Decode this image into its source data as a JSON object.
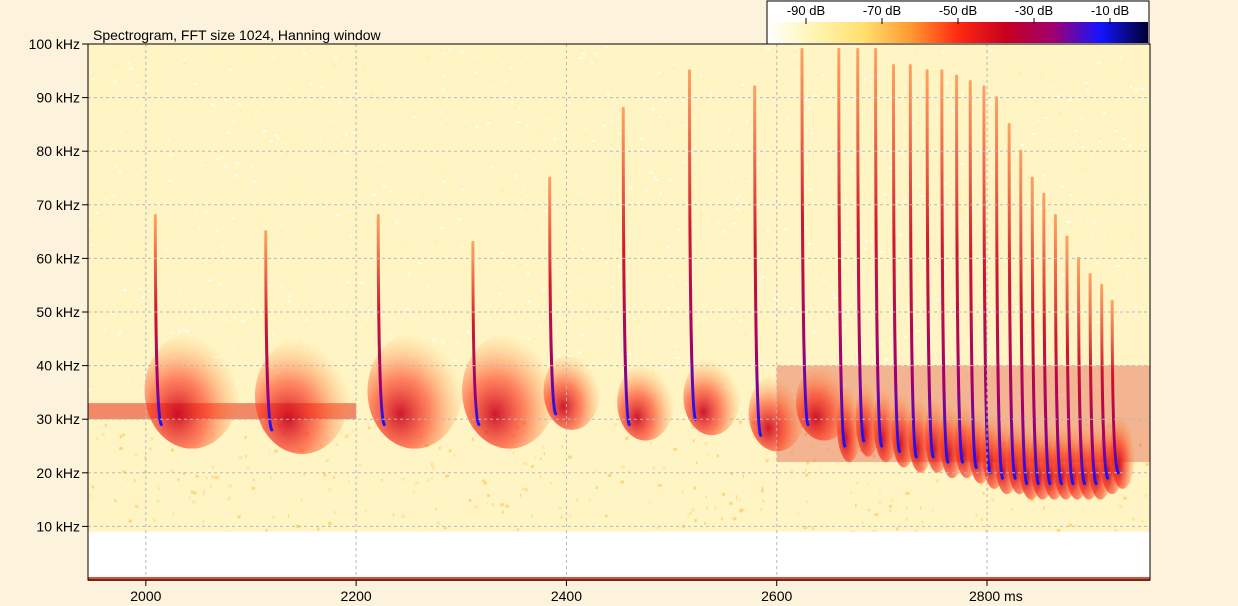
{
  "chart_data": {
    "type": "heatmap",
    "title": "Spectrogram, FFT size 1024, Hanning window",
    "x_unit_label": "ms",
    "y_unit_label": "kHz",
    "xlim": [
      1945,
      2955
    ],
    "ylim": [
      0,
      100
    ],
    "x_ticks": [
      2000,
      2200,
      2400,
      2600,
      2800
    ],
    "y_ticks": [
      10,
      20,
      30,
      40,
      50,
      60,
      70,
      80,
      90,
      100
    ],
    "x_tick_labels": [
      "2000",
      "2200",
      "2400",
      "2600",
      "2800 ms"
    ],
    "y_tick_labels": [
      "10 kHz",
      "20 kHz",
      "30 kHz",
      "40 kHz",
      "50 kHz",
      "60 kHz",
      "70 kHz",
      "80 kHz",
      "90 kHz",
      "100 kHz"
    ],
    "grid": true,
    "colorbar": {
      "range_db": [
        -100,
        0
      ],
      "ticks_db": [
        -90,
        -70,
        -50,
        -30,
        -10
      ],
      "tick_labels": [
        "-90 dB",
        "-70 dB",
        "-50 dB",
        "-30 dB",
        "-10 dB"
      ],
      "placement": "top-right",
      "colors": [
        "#ffffff",
        "#fff4b0",
        "#ffe070",
        "#ff9a30",
        "#ff2a10",
        "#c8001e",
        "#a00070",
        "#1414ff",
        "#000030"
      ]
    },
    "calls": [
      {
        "t": 2010,
        "f_start": 68,
        "f_end": 29
      },
      {
        "t": 2115,
        "f_start": 65,
        "f_end": 28
      },
      {
        "t": 2222,
        "f_start": 68,
        "f_end": 29
      },
      {
        "t": 2312,
        "f_start": 63,
        "f_end": 29
      },
      {
        "t": 2385,
        "f_start": 75,
        "f_end": 31
      },
      {
        "t": 2455,
        "f_start": 88,
        "f_end": 29
      },
      {
        "t": 2518,
        "f_start": 95,
        "f_end": 30
      },
      {
        "t": 2580,
        "f_start": 92,
        "f_end": 27
      },
      {
        "t": 2625,
        "f_start": 99,
        "f_end": 29
      },
      {
        "t": 2660,
        "f_start": 99,
        "f_end": 25
      },
      {
        "t": 2678,
        "f_start": 99,
        "f_end": 26
      },
      {
        "t": 2695,
        "f_start": 99,
        "f_end": 25
      },
      {
        "t": 2712,
        "f_start": 96,
        "f_end": 24
      },
      {
        "t": 2728,
        "f_start": 96,
        "f_end": 23
      },
      {
        "t": 2744,
        "f_start": 95,
        "f_end": 23
      },
      {
        "t": 2758,
        "f_start": 95,
        "f_end": 22
      },
      {
        "t": 2772,
        "f_start": 94,
        "f_end": 22
      },
      {
        "t": 2785,
        "f_start": 93,
        "f_end": 21
      },
      {
        "t": 2798,
        "f_start": 92,
        "f_end": 20
      },
      {
        "t": 2810,
        "f_start": 90,
        "f_end": 19
      },
      {
        "t": 2822,
        "f_start": 85,
        "f_end": 19
      },
      {
        "t": 2833,
        "f_start": 80,
        "f_end": 18
      },
      {
        "t": 2844,
        "f_start": 75,
        "f_end": 18
      },
      {
        "t": 2855,
        "f_start": 72,
        "f_end": 18
      },
      {
        "t": 2866,
        "f_start": 68,
        "f_end": 18
      },
      {
        "t": 2877,
        "f_start": 64,
        "f_end": 18
      },
      {
        "t": 2888,
        "f_start": 60,
        "f_end": 18
      },
      {
        "t": 2899,
        "f_start": 57,
        "f_end": 18
      },
      {
        "t": 2910,
        "f_start": 55,
        "f_end": 19
      },
      {
        "t": 2920,
        "f_start": 52,
        "f_end": 20
      }
    ],
    "constant_band_khz": [
      30,
      33
    ],
    "energy_floor_khz": 9
  }
}
